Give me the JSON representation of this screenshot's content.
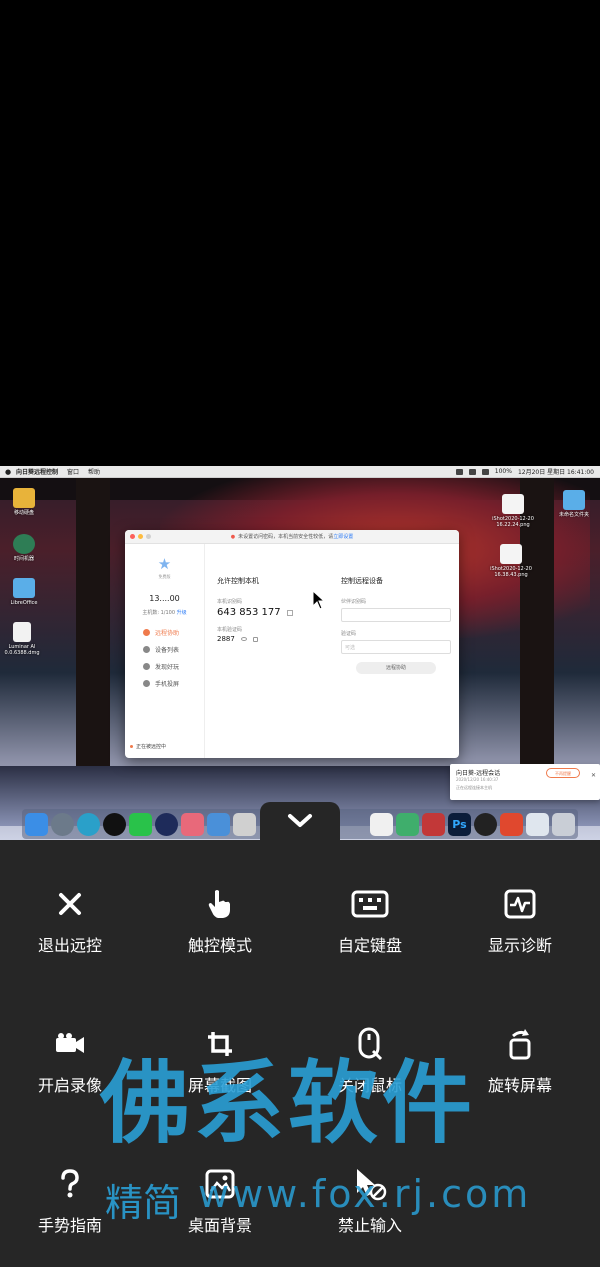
{
  "menubar": {
    "app_name": "向日葵远程控制",
    "items": [
      "窗口",
      "帮助"
    ],
    "battery": "100%",
    "datetime": "12月20日 星期日 16:41:00"
  },
  "desktop": {
    "icons_left": [
      {
        "label": "移动硬盘",
        "icon": "drive-icon"
      },
      {
        "label": "时间机器",
        "icon": "time-machine-icon"
      },
      {
        "label": "LibreOffice",
        "icon": "folder-icon"
      },
      {
        "label": "Luminar AI 0.0.6388.dmg",
        "icon": "dmg-icon"
      }
    ],
    "icons_right": [
      {
        "label": "未命名文件夹",
        "icon": "folder-icon"
      },
      {
        "label": "iShot2020-12-20 16.22.24.png",
        "icon": "image-file-icon"
      },
      {
        "label": "iShot2020-12-20 16.38.43.png",
        "icon": "image-file-icon"
      }
    ]
  },
  "app_window": {
    "notice": "未设置访问密码，本机当前安全性较低，请",
    "notice_link": "立即设置",
    "level": "免费版",
    "user_id": "13....00",
    "device_count": "主机数: 1/100",
    "upgrade": "升级",
    "nav": [
      "远程协助",
      "设备列表",
      "发现好玩",
      "手机投屏"
    ],
    "status": "正在被远控中",
    "allow_title": "允许控制本机",
    "local_id_label": "本机识别码",
    "local_id": "643 853 177",
    "local_code_label": "本机验证码",
    "local_code": "2887",
    "control_title": "控制远程设备",
    "partner_id_label": "伙伴识别码",
    "verify_label": "验证码",
    "verify_placeholder": "可选",
    "connect_button": "远程协助"
  },
  "notification": {
    "title": "向日葵-远程会话",
    "time": "2020/12/20 16:40:37",
    "status": "正在远程连接本主机",
    "button": "不再提醒"
  },
  "controls": [
    {
      "label": "退出远控",
      "icon": "close-icon"
    },
    {
      "label": "触控模式",
      "icon": "touch-hand-icon"
    },
    {
      "label": "自定键盘",
      "icon": "keyboard-icon"
    },
    {
      "label": "显示诊断",
      "icon": "diagnostics-icon"
    },
    {
      "label": "开启录像",
      "icon": "video-camera-icon"
    },
    {
      "label": "屏幕截图",
      "icon": "crop-icon"
    },
    {
      "label": "关闭鼠标",
      "icon": "mouse-off-icon"
    },
    {
      "label": "旋转屏幕",
      "icon": "rotate-icon"
    },
    {
      "label": "手势指南",
      "icon": "help-icon"
    },
    {
      "label": "桌面背景",
      "icon": "image-icon"
    },
    {
      "label": "禁止输入",
      "icon": "cursor-block-icon"
    }
  ],
  "watermark": {
    "main": "佛系软件",
    "sub1": "精简",
    "sub2": "www.fox.rj.com"
  },
  "colors": {
    "panel_bg": "#262626",
    "accent_orange": "#ef7a4c",
    "link_blue": "#2d7cf6",
    "watermark_blue": "#2a9fd6"
  }
}
